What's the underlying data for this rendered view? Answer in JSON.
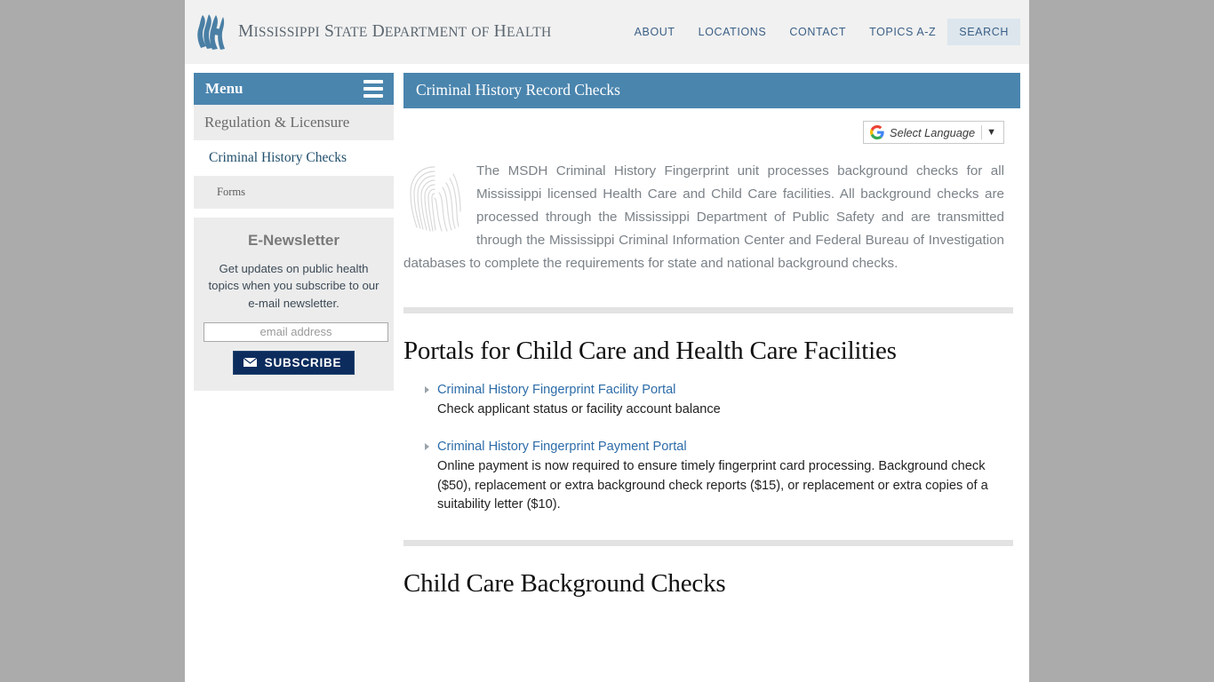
{
  "header": {
    "logo_icon": "msdh-logo-icon",
    "brand_name_parts": [
      {
        "big": "M",
        "small": "ISSISSIPPI"
      },
      {
        "big": "S",
        "small": "TATE"
      },
      {
        "big": "D",
        "small": "EPARTMENT"
      },
      {
        "big": "",
        "small": "OF"
      },
      {
        "big": "H",
        "small": "EALTH"
      }
    ],
    "brand_name_plain": "Mississippi State Department of Health",
    "nav": [
      {
        "label": "ABOUT",
        "active": false
      },
      {
        "label": "LOCATIONS",
        "active": false
      },
      {
        "label": "CONTACT",
        "active": false
      },
      {
        "label": "TOPICS A-Z",
        "active": false
      },
      {
        "label": "SEARCH",
        "active": true
      }
    ]
  },
  "sidebar": {
    "menu_label": "Menu",
    "menu_icon": "hamburger-icon",
    "items": [
      {
        "label": "Regulation & Licensure",
        "level": 1
      },
      {
        "label": "Criminal History Checks",
        "level": 2
      },
      {
        "label": "Forms",
        "level": 3
      }
    ],
    "newsletter": {
      "title": "E-Newsletter",
      "description": "Get updates on public health topics when you subscribe to our e-mail newsletter.",
      "email_placeholder": "email address",
      "email_value": "",
      "subscribe_label": "SUBSCRIBE",
      "subscribe_icon": "envelope-icon"
    }
  },
  "main": {
    "page_title": "Criminal History Record Checks",
    "translate": {
      "icon": "google-g-icon",
      "label": "Select Language",
      "caret_icon": "triangle-down-icon"
    },
    "intro": {
      "image_icon": "fingerprint-image",
      "text": "The MSDH Criminal History Fingerprint unit processes background checks for all Mississippi licensed Health Care and Child Care facilities. All background checks are processed through the Mississippi Department of Public Safety and are transmitted through the Mississippi Criminal Information Center and Federal Bureau of Investigation databases to complete the requirements for state and national background checks."
    },
    "sections": [
      {
        "heading": "Portals for Child Care and Health Care Facilities",
        "links": [
          {
            "label": "Criminal History Fingerprint Facility Portal",
            "description": "Check applicant status or facility account balance"
          },
          {
            "label": "Criminal History Fingerprint Payment Portal",
            "description": "Online payment is now required to ensure timely fingerprint card processing. Background check ($50), replacement or extra background check reports ($15), or replacement or extra copies of a suitability letter ($10)."
          }
        ]
      },
      {
        "heading": "Child Care Background Checks"
      }
    ]
  },
  "colors": {
    "page_background": "#ababab",
    "header_background": "#f1f1f1",
    "accent_blue": "#4a85ae",
    "link_blue": "#2d6ca8",
    "subscribe_navy": "#0c2c5e",
    "sidebar_gray": "#ececec"
  }
}
